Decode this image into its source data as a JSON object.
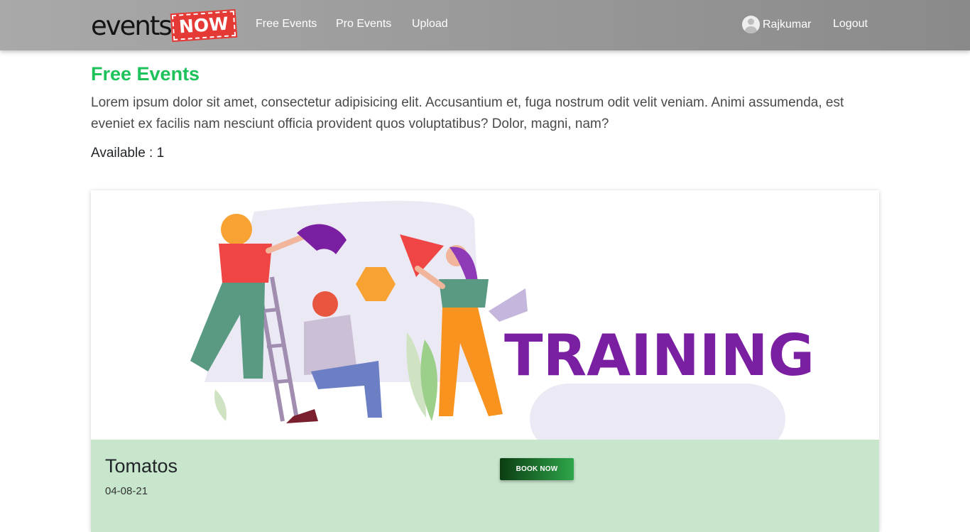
{
  "navbar": {
    "logo_text": "events",
    "logo_badge": "NOW",
    "links": [
      "Free Events",
      "Pro Events",
      "Upload"
    ],
    "user": "Rajkumar",
    "logout": "Logout"
  },
  "page": {
    "title": "Free Events",
    "description": "Lorem ipsum dolor sit amet, consectetur adipisicing elit. Accusantium et, fuga nostrum odit velit veniam. Animi assumenda, est eveniet ex facilis nam nesciunt officia provident quos voluptatibus? Dolor, magni, nam?",
    "available": "Available : 1"
  },
  "event_card": {
    "image_text": "TRAINING",
    "name": "Tomatos",
    "date": "04-08-21",
    "book_label": "BOOK NOW"
  },
  "colors": {
    "title_green": "#1ec25b",
    "card_body": "#c8e6cc",
    "training_purple": "#7b1fa2"
  }
}
